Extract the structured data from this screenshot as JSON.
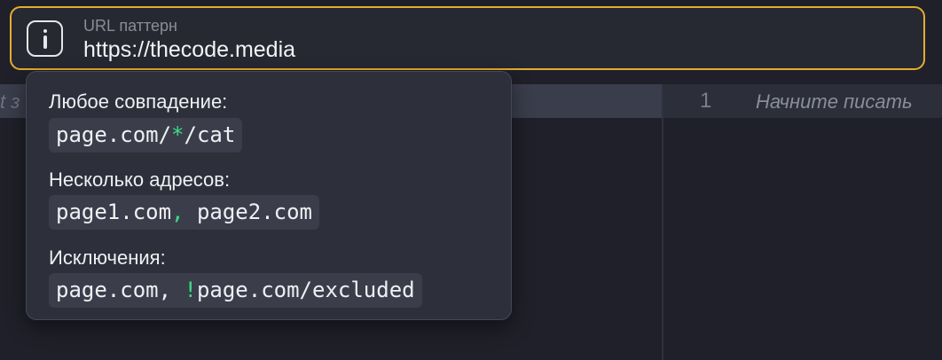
{
  "url_field": {
    "label": "URL паттерн",
    "value": "https://thecode.media",
    "icon": "info-icon",
    "border_color": "#e5ad2d"
  },
  "left_pane": {
    "placeholder": "t з"
  },
  "editor": {
    "line_number": "1",
    "placeholder": "Начните писать"
  },
  "tooltip": {
    "accent_color": "#3ddc84",
    "sections": [
      {
        "label": "Любое совпадение:",
        "code_before": "page.com/",
        "code_accent": "*",
        "code_after": "/cat"
      },
      {
        "label": "Несколько адресов:",
        "code_before": "page1.com",
        "code_accent": ",",
        "code_after": " page2.com"
      },
      {
        "label": "Исключения:",
        "code_before": "page.com, ",
        "code_accent": "!",
        "code_after": "page.com/excluded"
      }
    ]
  }
}
